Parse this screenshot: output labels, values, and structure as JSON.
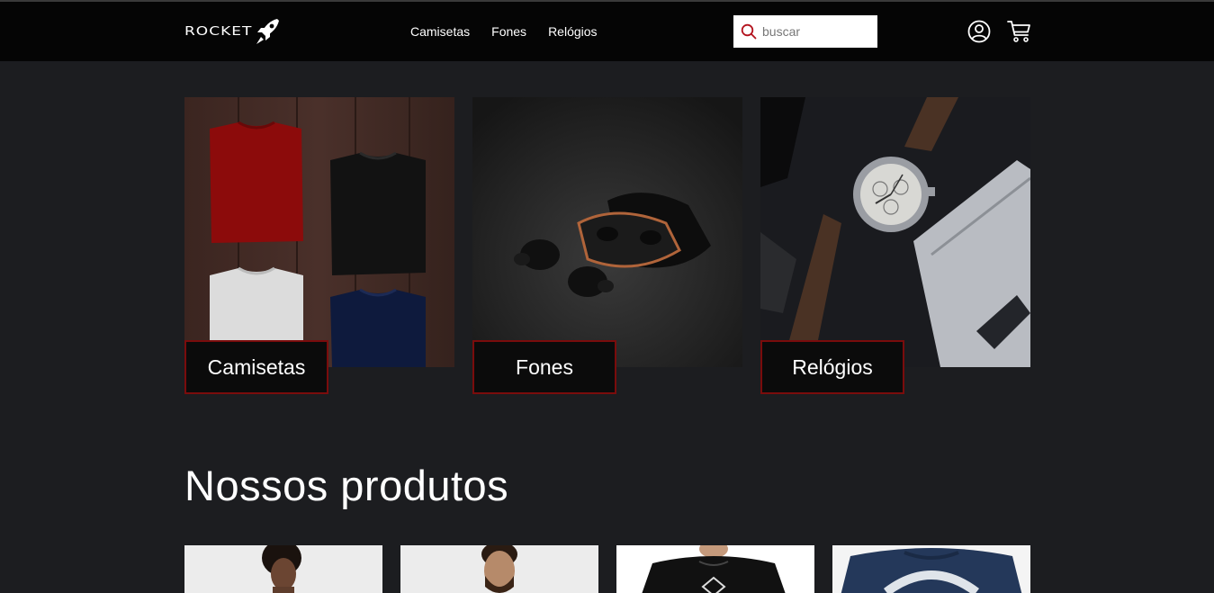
{
  "brand": {
    "logo_text": "ROCKET"
  },
  "nav": {
    "items": [
      {
        "label": "Camisetas"
      },
      {
        "label": "Fones"
      },
      {
        "label": "Relógios"
      }
    ]
  },
  "search": {
    "placeholder": "buscar",
    "icon": "search-icon"
  },
  "header_icons": {
    "account": "user-icon",
    "cart": "cart-icon"
  },
  "categories": [
    {
      "label": "Camisetas"
    },
    {
      "label": "Fones"
    },
    {
      "label": "Relógios"
    }
  ],
  "products_section": {
    "title": "Nossos produtos"
  },
  "colors": {
    "background": "#1c1d20",
    "header": "#050505",
    "accent_border": "#7a0c0c",
    "search_icon": "#b3121d"
  }
}
